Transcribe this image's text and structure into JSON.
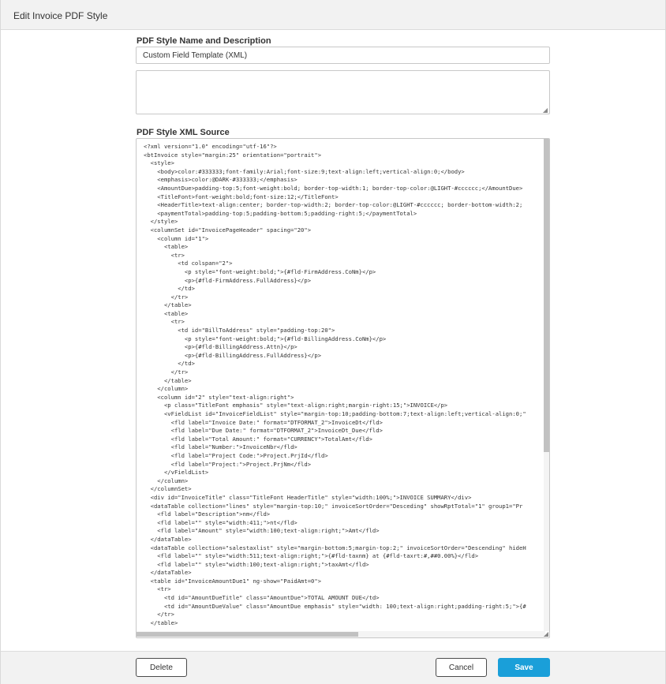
{
  "dialog": {
    "title": "Edit Invoice PDF Style"
  },
  "name_section": {
    "label": "PDF Style Name and Description",
    "name_value": "Custom Field Template (XML)",
    "description_value": ""
  },
  "xml_section": {
    "label": "PDF Style XML Source",
    "lines": [
      "<?xml version=\"1.0\" encoding=\"utf-16\"?>",
      "<btInvoice style=\"margin:25\" orientation=\"portrait\">",
      "  <style>",
      "    <body>color:#333333;font-family:Arial;font-size:9;text-align:left;vertical-align:0;</body>",
      "    <emphasis>color:@DARK-#333333;</emphasis>",
      "    <AmountDue>padding-top:5;font-weight:bold; border-top-width:1; border-top-color:@LIGHT-#cccccc;</AmountDue>",
      "    <TitleFont>font-weight:bold;font-size:12;</TitleFont>",
      "    <HeaderTitle>text-align:center; border-top-width:2; border-top-color:@LIGHT-#cccccc; border-bottom-width:2;",
      "    <paymentTotal>padding-top:5;padding-bottom:5;padding-right:5;</paymentTotal>",
      "  </style>",
      "  <columnSet id=\"InvoicePageHeader\" spacing=\"20\">",
      "    <column id=\"1\">",
      "      <table>",
      "        <tr>",
      "          <td colspan=\"2\">",
      "            <p style=\"font-weight:bold;\">{#fld-FirmAddress.CoNm}</p>",
      "            <p>{#fld-FirmAddress.FullAddress}</p>",
      "          </td>",
      "        </tr>",
      "      </table>",
      "      <table>",
      "        <tr>",
      "          <td id=\"BillToAddress\" style=\"padding-top:20\">",
      "            <p style=\"font-weight:bold;\">{#fld-BillingAddress.CoNm}</p>",
      "            <p>{#fld-BillingAddress.Attn}</p>",
      "            <p>{#fld-BillingAddress.FullAddress}</p>",
      "          </td>",
      "        </tr>",
      "      </table>",
      "    </column>",
      "    <column id=\"2\" style=\"text-align:right\">",
      "      <p class=\"TitleFont emphasis\" style=\"text-align:right;margin-right:15;\">INVOICE</p>",
      "      <vFieldList id=\"InvoiceFieldList\" style=\"margin-top:10;padding-bottom:7;text-align:left;vertical-align:0;\"",
      "        <fld label=\"Invoice Date:\" format=\"DTFORMAT_2\">InvoiceDt</fld>",
      "        <fld label=\"Due Date:\" format=\"DTFORMAT_2\">InvoiceDt_Due</fld>",
      "        <fld label=\"Total Amount:\" format=\"CURRENCY\">TotalAmt</fld>",
      "        <fld label=\"Number:\">InvoiceNbr</fld>",
      "        <fld label=\"Project Code:\">Project.PrjId</fld>",
      "        <fld label=\"Project:\">Project.PrjNm</fld>",
      "      </vFieldList>",
      "    </column>",
      "  </columnSet>",
      "  <div id=\"InvoiceTitle\" class=\"TitleFont HeaderTitle\" style=\"width:100%;\">INVOICE SUMMARY</div>",
      "  <dataTable collection=\"lines\" style=\"margin-top:10;\" invoiceSortOrder=\"Desceding\" showRptTotal=\"1\" group1=\"Pr",
      "    <fld label=\"Description\">nm</fld>",
      "    <fld label=\"\" style=\"width:411;\">nt</fld>",
      "    <fld label=\"Amount\" style=\"width:100;text-align:right;\">Amt</fld>",
      "  </dataTable>",
      "  <dataTable collection=\"salestaxlist\" style=\"margin-bottom:5;margin-top:2;\" invoiceSortOrder=\"Descending\" hideH",
      "    <fld label=\"\" style=\"width:511;text-align:right;\">{#fld-taxnm} at {#fld-taxrt:#,##0.00%}</fld>",
      "    <fld label=\"\" style=\"width:100;text-align:right;\">taxAmt</fld>",
      "  </dataTable>",
      "  <table id=\"InvoiceAmountDue1\" ng-show=\"PaidAmt=0\">",
      "    <tr>",
      "      <td id=\"AmountDueTitle\" class=\"AmountDue\">TOTAL AMOUNT DUE</td>",
      "      <td id=\"AmountDueValue\" class=\"AmountDue emphasis\" style=\"width: 100;text-align:right;padding-right:5;\">{#",
      "    </tr>",
      "  </table>"
    ]
  },
  "footer": {
    "delete_label": "Delete",
    "cancel_label": "Cancel",
    "save_label": "Save"
  },
  "colors": {
    "primary": "#1a9fd9",
    "primary_text": "#ffffff"
  }
}
